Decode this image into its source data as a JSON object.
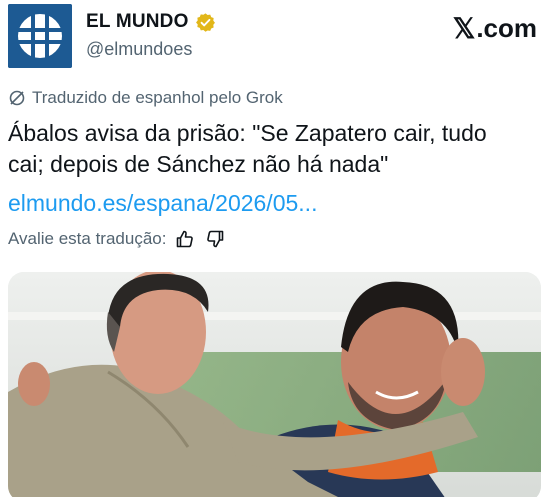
{
  "account": {
    "name": "EL MUNDO",
    "handle": "@elmundoes",
    "avatar_icon": "globe-logo-icon",
    "verified_icon": "gold-verified-badge-icon"
  },
  "site": {
    "label": ".com",
    "logo_icon": "x-logo-icon"
  },
  "translation": {
    "icon": "translate-icon",
    "label": "Traduzido de espanhol pelo Grok"
  },
  "post": {
    "text_line1": "Ábalos avisa da prisão: \"Se Zapatero cair, tudo",
    "text_line2": "cai; depois de Sánchez não há nada\"",
    "link": "elmundo.es/espana/2026/05..."
  },
  "rating": {
    "label": "Avalie esta tradução:",
    "like_icon": "thumbs-up-icon",
    "dislike_icon": "thumbs-down-icon"
  },
  "media": {
    "icon": "photo-two-men-embracing"
  },
  "colors": {
    "link": "#1d9bf0",
    "secondary_text": "#536471",
    "avatar_bg": "#1d5a93",
    "verified_gold": "#e2b719"
  }
}
